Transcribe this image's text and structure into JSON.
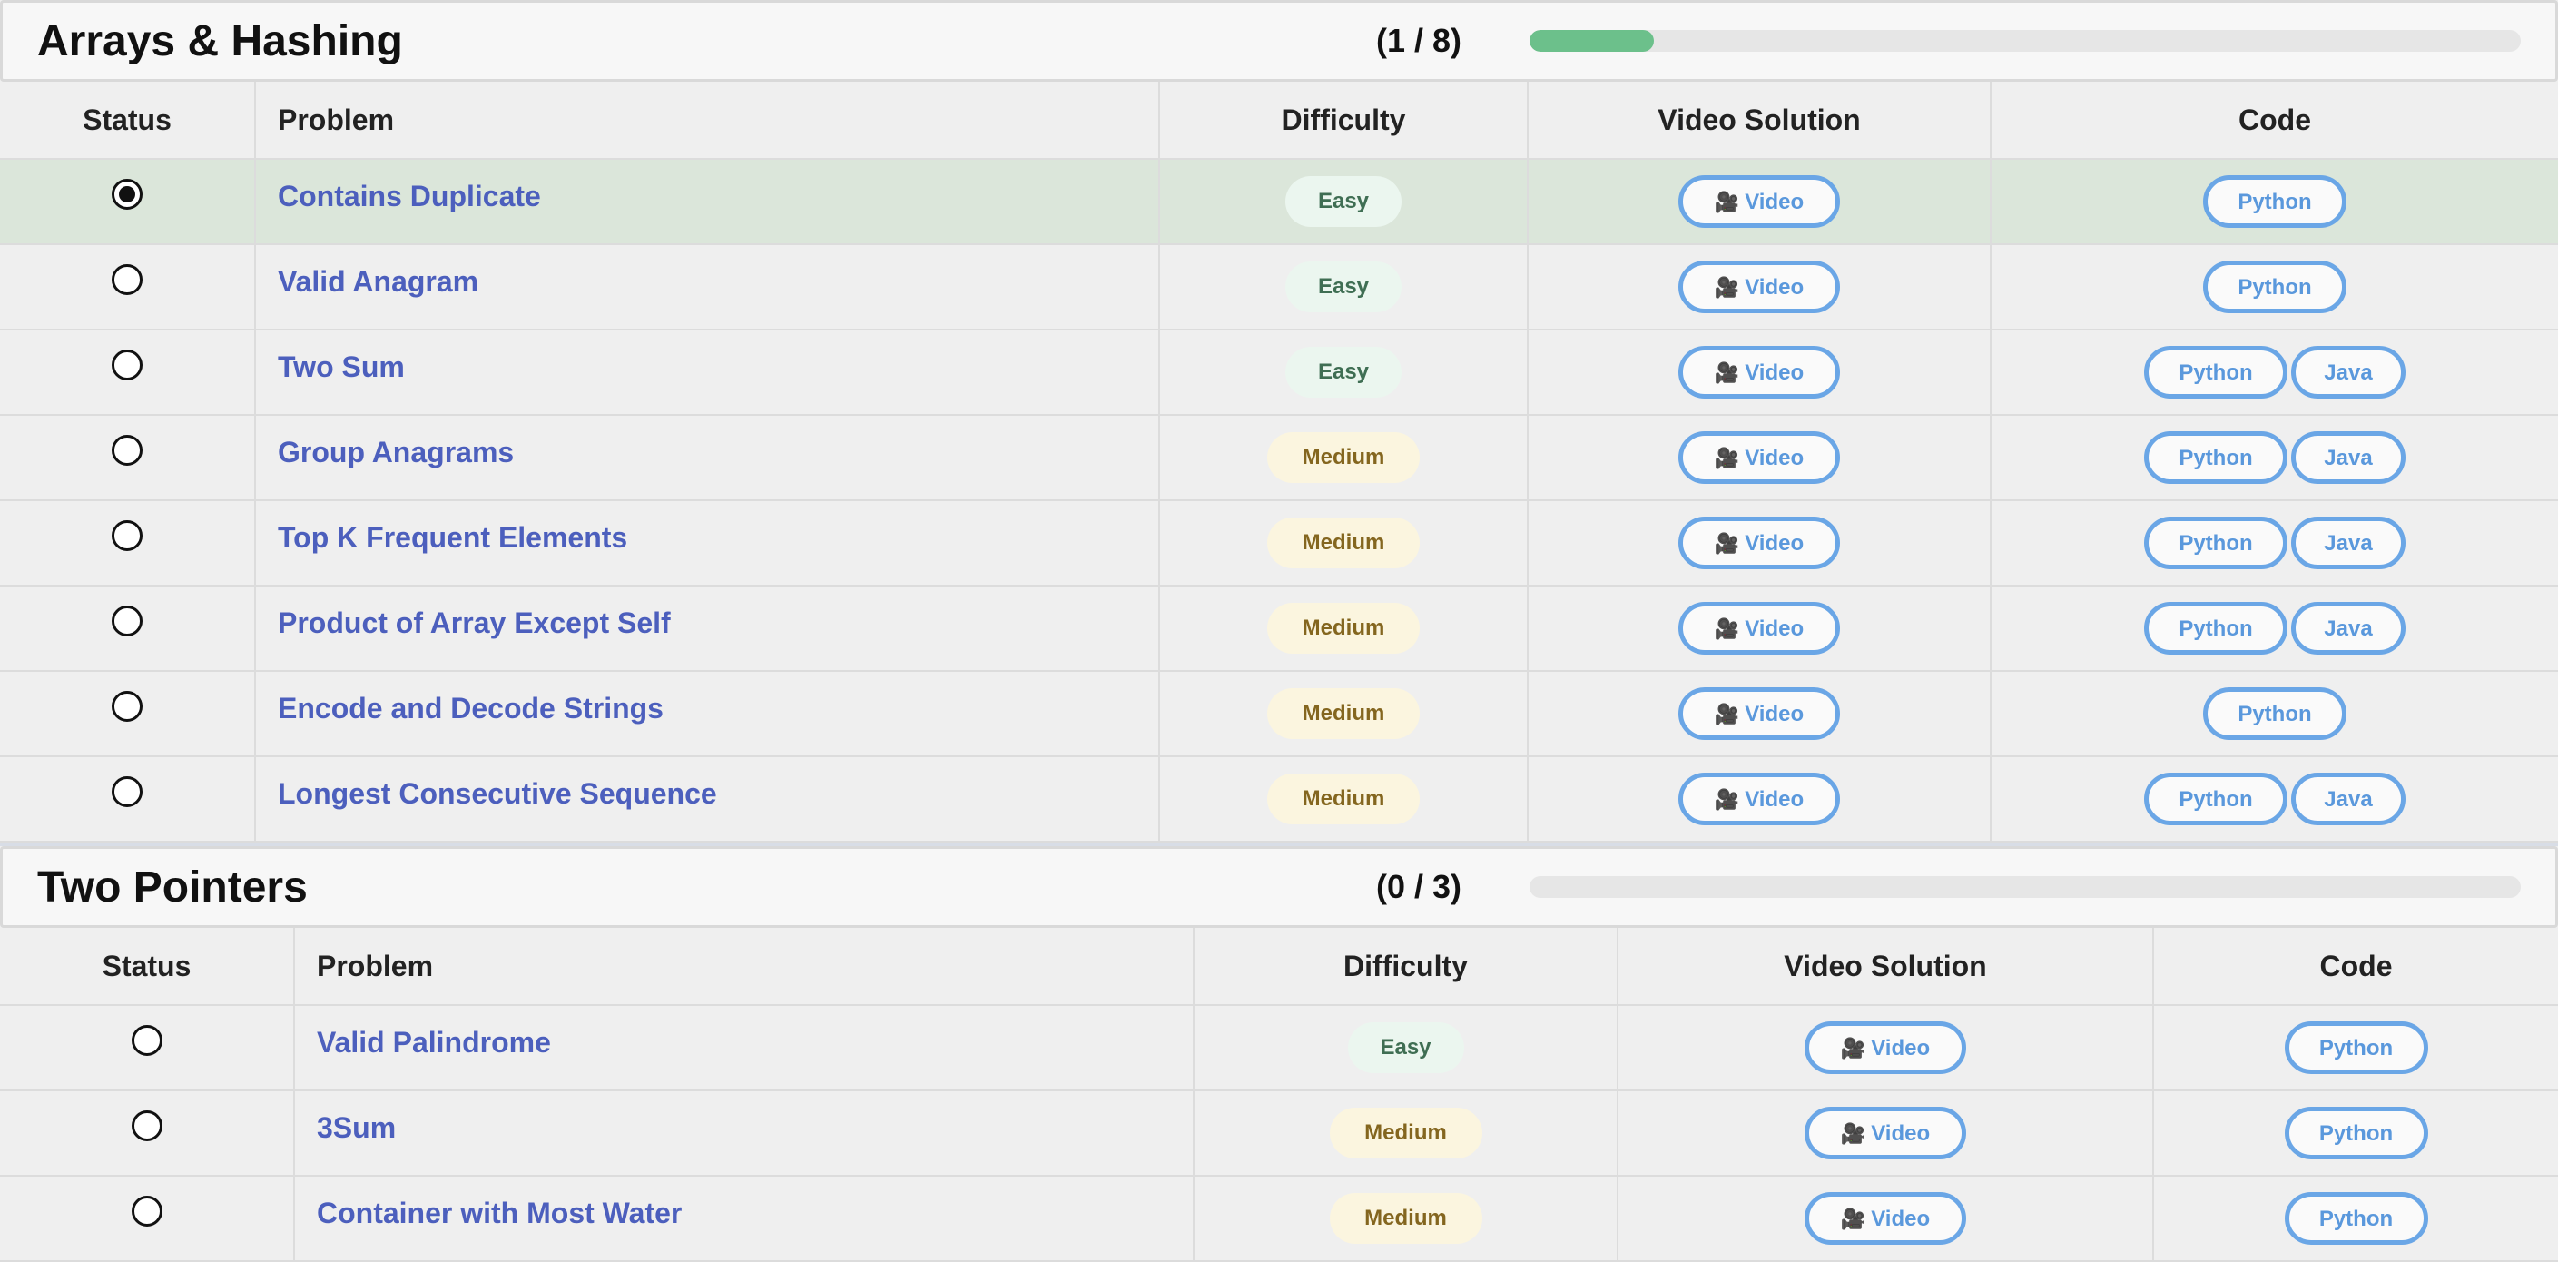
{
  "sections": [
    {
      "title": "Arrays & Hashing",
      "count": "(1 / 8)",
      "progress": 0.125,
      "columns": [
        "Status",
        "Problem",
        "Difficulty",
        "Video Solution",
        "Code"
      ],
      "rows": [
        {
          "name": "Contains Duplicate",
          "done": true,
          "difficulty": "Easy",
          "video": "Video",
          "code": [
            "Python"
          ]
        },
        {
          "name": "Valid Anagram",
          "done": false,
          "difficulty": "Easy",
          "video": "Video",
          "code": [
            "Python"
          ]
        },
        {
          "name": "Two Sum",
          "done": false,
          "difficulty": "Easy",
          "video": "Video",
          "code": [
            "Python",
            "Java"
          ]
        },
        {
          "name": "Group Anagrams",
          "done": false,
          "difficulty": "Medium",
          "video": "Video",
          "code": [
            "Python",
            "Java"
          ]
        },
        {
          "name": "Top K Frequent Elements",
          "done": false,
          "difficulty": "Medium",
          "video": "Video",
          "code": [
            "Python",
            "Java"
          ]
        },
        {
          "name": "Product of Array Except Self",
          "done": false,
          "difficulty": "Medium",
          "video": "Video",
          "code": [
            "Python",
            "Java"
          ]
        },
        {
          "name": "Encode and Decode Strings",
          "done": false,
          "difficulty": "Medium",
          "video": "Video",
          "code": [
            "Python"
          ]
        },
        {
          "name": "Longest Consecutive Sequence",
          "done": false,
          "difficulty": "Medium",
          "video": "Video",
          "code": [
            "Python",
            "Java"
          ]
        }
      ]
    },
    {
      "title": "Two Pointers",
      "count": "(0 / 3)",
      "progress": 0,
      "columns": [
        "Status",
        "Problem",
        "Difficulty",
        "Video Solution",
        "Code"
      ],
      "rows": [
        {
          "name": "Valid Palindrome",
          "done": false,
          "difficulty": "Easy",
          "video": "Video",
          "code": [
            "Python"
          ]
        },
        {
          "name": "3Sum",
          "done": false,
          "difficulty": "Medium",
          "video": "Video",
          "code": [
            "Python"
          ]
        },
        {
          "name": "Container with Most Water",
          "done": false,
          "difficulty": "Medium",
          "video": "Video",
          "code": [
            "Python"
          ]
        }
      ]
    }
  ],
  "icons": {
    "video": "movie-camera-icon"
  },
  "colors": {
    "progress": "#6cc08b",
    "link": "#4c5fbd",
    "pill_border": "#6aa6e6",
    "done_row": "#dbe6da"
  }
}
